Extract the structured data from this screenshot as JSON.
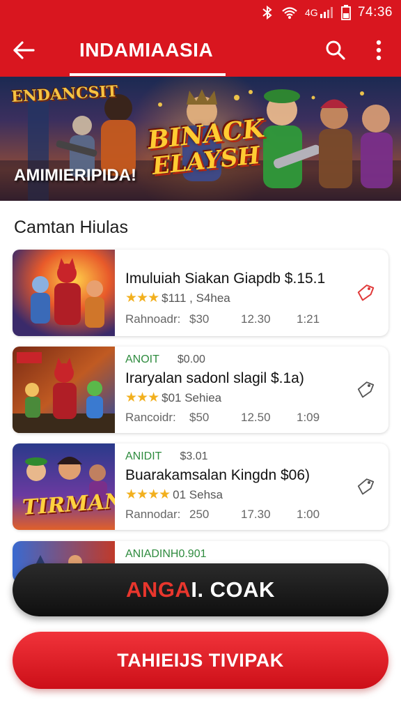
{
  "status_bar": {
    "time": "74:36"
  },
  "app_bar": {
    "title": "INDAMIAASIA"
  },
  "banner": {
    "tag": "ENDANCSIT",
    "logo_line1": "BINACK",
    "logo_line2": "ELAYSH",
    "caption": "AMIMIERIPIDA!"
  },
  "section": {
    "title": "Camtan Hiulas"
  },
  "games": [
    {
      "meta_left": "",
      "meta_right": "",
      "title": "Imuluiah Siakan Giapdb $.15.1",
      "stars": "★★★",
      "rating_text": "$111 , S4hea",
      "stats_label": "Rahnoadr:",
      "stat1": "$30",
      "stat2": "12.30",
      "stat3": "1:21",
      "thumb_text": ""
    },
    {
      "meta_left": "ANOIT",
      "meta_right": "$0.00",
      "title": "Iraryalan sadonl slagil $.1a)",
      "stars": "★★★",
      "rating_text": "$01 Sehiea",
      "stats_label": "Rancoidr:",
      "stat1": "$50",
      "stat2": "12.50",
      "stat3": "1:09",
      "thumb_text": ""
    },
    {
      "meta_left": "ANIDIT",
      "meta_right": "$3.01",
      "title": "Buarakamsalan Kingdn $06)",
      "stars": "★★★★",
      "rating_text": "01 Sehsa",
      "stats_label": "Rannodar:",
      "stat1": "250",
      "stat2": "17.30",
      "stat3": "1:00",
      "thumb_text": "TIRMAN"
    },
    {
      "meta_left": "ANIADINH0.901",
      "meta_right": ""
    }
  ],
  "buttons": {
    "primary_part1": "ANGA",
    "primary_part2": "I. COAK",
    "secondary": "TAHIEIJS TIVIPAK"
  },
  "colors": {
    "brand_red": "#d9161f",
    "dark_button": "#111111",
    "accent_green": "#2e8b3e",
    "star": "#f2b01e"
  }
}
